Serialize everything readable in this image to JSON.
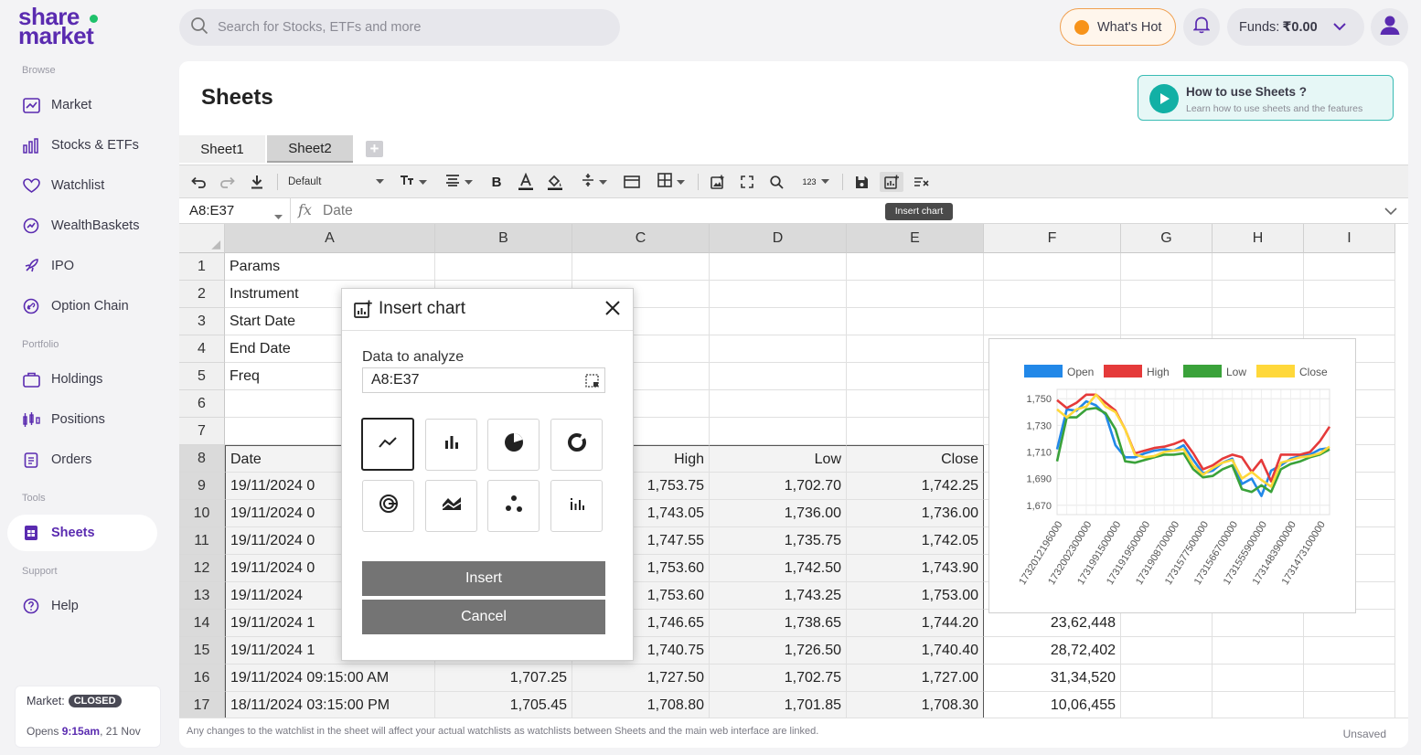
{
  "brand": {
    "line1": "share",
    "line2": "market"
  },
  "sidebar": {
    "sections": {
      "browse": "Browse",
      "portfolio": "Portfolio",
      "tools": "Tools",
      "support": "Support"
    },
    "items": [
      {
        "label": "Market",
        "icon": "chart-line-icon"
      },
      {
        "label": "Stocks & ETFs",
        "icon": "bars-icon"
      },
      {
        "label": "Watchlist",
        "icon": "heart-icon"
      },
      {
        "label": "WealthBaskets",
        "icon": "basket-icon"
      },
      {
        "label": "IPO",
        "icon": "rocket-icon"
      },
      {
        "label": "Option Chain",
        "icon": "link-icon"
      },
      {
        "label": "Holdings",
        "icon": "briefcase-icon"
      },
      {
        "label": "Positions",
        "icon": "candles-icon"
      },
      {
        "label": "Orders",
        "icon": "clipboard-icon"
      },
      {
        "label": "Sheets",
        "icon": "sheet-icon"
      },
      {
        "label": "Help",
        "icon": "question-icon"
      }
    ],
    "market": {
      "label": "Market:",
      "status": "CLOSED",
      "opens_prefix": "Opens",
      "opens_time": "9:15am",
      "opens_date": ", 21 Nov"
    }
  },
  "topbar": {
    "search_placeholder": "Search for Stocks, ETFs and more",
    "whats_hot": "What's Hot",
    "funds_label": "Funds:",
    "funds_value": "₹0.00"
  },
  "page": {
    "title": "Sheets",
    "howto_title": "How to use Sheets ?",
    "howto_sub": "Learn how to use sheets and the features",
    "tabs": [
      "Sheet1",
      "Sheet2"
    ],
    "active_tab": "Sheet2",
    "add_tab": "+"
  },
  "toolbar": {
    "font": "Default",
    "number_format": "123",
    "tooltip": "Insert chart"
  },
  "formula": {
    "cell_ref": "A8:E37",
    "fx": "fx",
    "value": "Date"
  },
  "grid": {
    "columns": [
      "A",
      "B",
      "C",
      "D",
      "E",
      "F",
      "G",
      "H",
      "I"
    ],
    "rows": [
      {
        "n": "1",
        "cells": [
          "Params",
          "",
          "",
          "",
          "",
          "",
          "",
          "",
          ""
        ]
      },
      {
        "n": "2",
        "cells": [
          "Instrument",
          "",
          "",
          "",
          "",
          "",
          "",
          "",
          ""
        ]
      },
      {
        "n": "3",
        "cells": [
          "Start Date",
          "",
          "",
          "",
          "",
          "",
          "",
          "",
          ""
        ]
      },
      {
        "n": "4",
        "cells": [
          "End Date",
          "",
          "",
          "",
          "",
          "",
          "",
          "",
          ""
        ]
      },
      {
        "n": "5",
        "cells": [
          "Freq",
          "",
          "",
          "",
          "",
          "",
          "",
          "",
          ""
        ]
      },
      {
        "n": "6",
        "cells": [
          "",
          "",
          "",
          "",
          "",
          "",
          "",
          "",
          ""
        ]
      },
      {
        "n": "7",
        "cells": [
          "",
          "",
          "",
          "",
          "",
          "",
          "",
          "",
          ""
        ]
      },
      {
        "n": "8",
        "cells": [
          "Date",
          "",
          "High",
          "Low",
          "Close",
          "",
          "",
          "",
          ""
        ]
      },
      {
        "n": "9",
        "cells": [
          "19/11/2024 0",
          "",
          "1,753.75",
          "1,702.70",
          "1,742.25",
          "",
          "",
          "",
          ""
        ]
      },
      {
        "n": "10",
        "cells": [
          "19/11/2024 0",
          "",
          "1,743.05",
          "1,736.00",
          "1,736.00",
          "",
          "",
          "",
          ""
        ]
      },
      {
        "n": "11",
        "cells": [
          "19/11/2024 0",
          "",
          "1,747.55",
          "1,735.75",
          "1,742.05",
          "",
          "",
          "",
          ""
        ]
      },
      {
        "n": "12",
        "cells": [
          "19/11/2024 0",
          "",
          "1,753.60",
          "1,742.50",
          "1,743.90",
          "",
          "",
          "",
          ""
        ]
      },
      {
        "n": "13",
        "cells": [
          "19/11/2024",
          "",
          "1,753.60",
          "1,743.25",
          "1,753.00",
          "",
          "",
          "",
          ""
        ]
      },
      {
        "n": "14",
        "cells": [
          "19/11/2024 1",
          "",
          "1,746.65",
          "1,738.65",
          "1,744.20",
          "23,62,448",
          "",
          "",
          ""
        ]
      },
      {
        "n": "15",
        "cells": [
          "19/11/2024 1",
          "",
          "1,740.75",
          "1,726.50",
          "1,740.40",
          "28,72,402",
          "",
          "",
          ""
        ]
      },
      {
        "n": "16",
        "cells": [
          "19/11/2024 09:15:00 AM",
          "1,707.25",
          "1,727.50",
          "1,702.75",
          "1,727.00",
          "31,34,520",
          "",
          "",
          ""
        ]
      },
      {
        "n": "17",
        "cells": [
          "18/11/2024 03:15:00 PM",
          "1,705.45",
          "1,708.80",
          "1,701.85",
          "1,708.30",
          "10,06,455",
          "",
          "",
          ""
        ]
      }
    ]
  },
  "footer": {
    "note": "Any changes to the watchlist in the sheet will affect your actual watchlists as watchlists between Sheets and the main web interface are linked.",
    "status": "Unsaved"
  },
  "modal": {
    "title": "Insert chart",
    "data_label": "Data to analyze",
    "range": "A8:E37",
    "chart_types": [
      "line",
      "bar",
      "pie",
      "doughnut",
      "radar",
      "area",
      "scatter",
      "column"
    ],
    "selected_type": "line",
    "insert": "Insert",
    "cancel": "Cancel"
  },
  "chart_data": {
    "type": "line",
    "series": [
      {
        "name": "Open",
        "color": "#2288e8",
        "values": [
          1712,
          1742,
          1741,
          1748,
          1745,
          1738,
          1715,
          1706,
          1706,
          1709,
          1711,
          1712,
          1711,
          1715,
          1704,
          1694,
          1696,
          1702,
          1705,
          1686,
          1690,
          1677,
          1696,
          1700,
          1705,
          1707,
          1708,
          1712,
          1713
        ]
      },
      {
        "name": "High",
        "color": "#e53a3a",
        "values": [
          1749,
          1743,
          1747,
          1753,
          1753,
          1747,
          1741,
          1727,
          1709,
          1711,
          1713,
          1714,
          1716,
          1719,
          1709,
          1697,
          1700,
          1705,
          1708,
          1706,
          1695,
          1704,
          1688,
          1708,
          1708,
          1708,
          1710,
          1718,
          1729
        ]
      },
      {
        "name": "Low",
        "color": "#3aa23a",
        "values": [
          1703,
          1736,
          1736,
          1742,
          1743,
          1739,
          1727,
          1703,
          1702,
          1704,
          1706,
          1708,
          1708,
          1709,
          1697,
          1691,
          1692,
          1697,
          1700,
          1682,
          1680,
          1685,
          1680,
          1697,
          1701,
          1703,
          1706,
          1708,
          1712
        ]
      },
      {
        "name": "Close",
        "color": "#ffd83a",
        "values": [
          1742,
          1736,
          1742,
          1744,
          1753,
          1744,
          1740,
          1727,
          1708,
          1706,
          1707,
          1710,
          1711,
          1712,
          1700,
          1693,
          1698,
          1702,
          1704,
          1690,
          1695,
          1689,
          1684,
          1702,
          1704,
          1706,
          1707,
          1709,
          1714
        ]
      }
    ],
    "x_tick_labels": [
      "1732012196000",
      "1732002300000",
      "1731991500000",
      "1731919500000",
      "1731908700000",
      "1731577500000",
      "1731566700000",
      "1731555900000",
      "1731483900000",
      "1731473100000"
    ],
    "y_ticks": [
      1670,
      1690,
      1710,
      1730,
      1750
    ],
    "y_tick_labels": [
      "1,670",
      "1,690",
      "1,710",
      "1,730",
      "1,750"
    ],
    "ylim": [
      1663,
      1757
    ],
    "legend": "top",
    "grid": true
  }
}
